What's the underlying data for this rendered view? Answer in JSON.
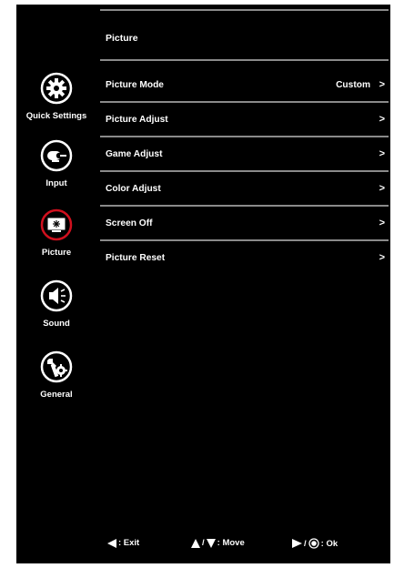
{
  "section_title": "Picture",
  "sidebar": {
    "items": [
      {
        "label": "Quick Settings",
        "icon": "gear-icon",
        "selected": false
      },
      {
        "label": "Input",
        "icon": "input-icon",
        "selected": false
      },
      {
        "label": "Picture",
        "icon": "picture-icon",
        "selected": true
      },
      {
        "label": "Sound",
        "icon": "speaker-icon",
        "selected": false
      },
      {
        "label": "General",
        "icon": "wrench-gear-icon",
        "selected": false
      }
    ]
  },
  "menu": {
    "items": [
      {
        "label": "Picture Mode",
        "value": "Custom",
        "chevron": ">"
      },
      {
        "label": "Picture Adjust",
        "value": "",
        "chevron": ">"
      },
      {
        "label": "Game Adjust",
        "value": "",
        "chevron": ">"
      },
      {
        "label": "Color Adjust",
        "value": "",
        "chevron": ">"
      },
      {
        "label": "Screen Off",
        "value": "",
        "chevron": ">"
      },
      {
        "label": "Picture Reset",
        "value": "",
        "chevron": ">"
      }
    ]
  },
  "footer": {
    "exit": ": Exit",
    "move_sep": "/",
    "move": ": Move",
    "ok_sep": "/",
    "ok": ": Ok"
  },
  "colors": {
    "background": "#000000",
    "text": "#ffffff",
    "divider": "#8a8a8a",
    "selected_ring": "#d0101e"
  }
}
